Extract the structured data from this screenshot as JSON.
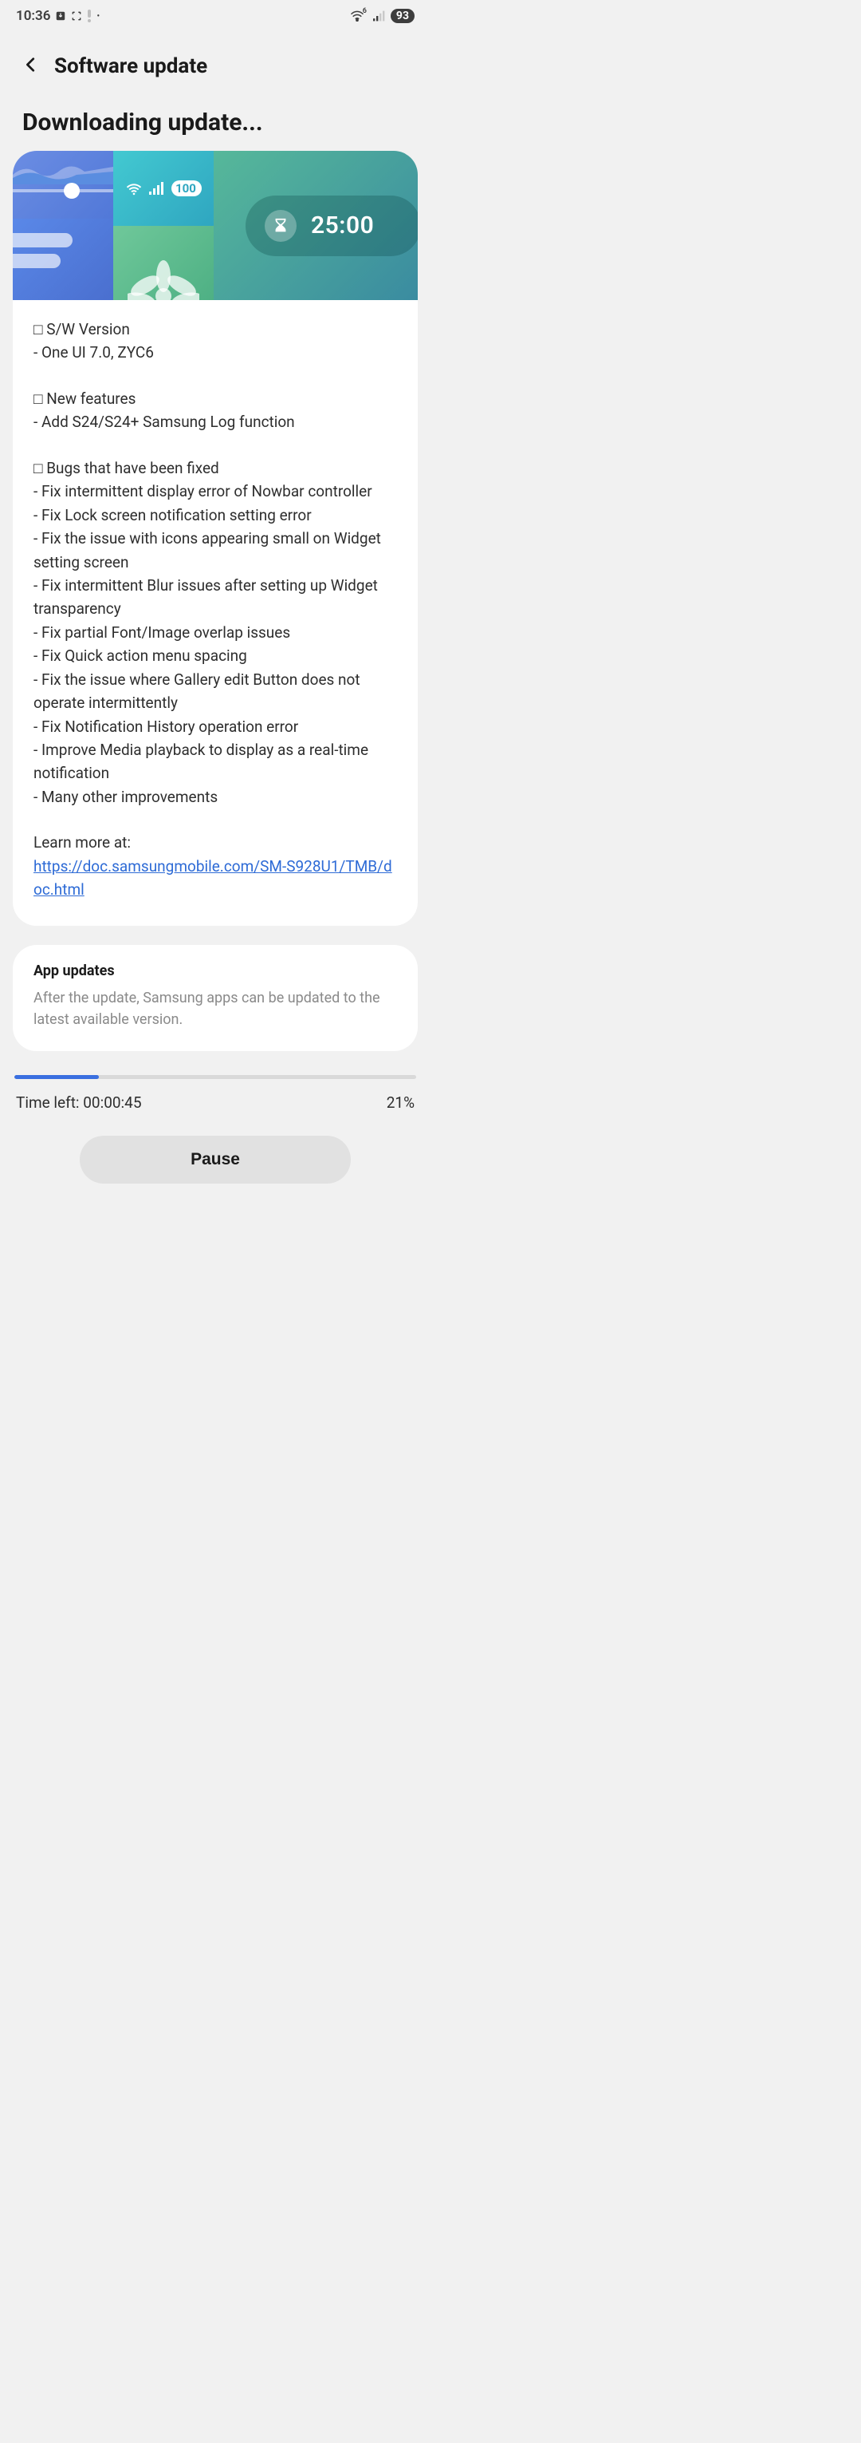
{
  "status_bar": {
    "time": "10:36",
    "battery": "93"
  },
  "header": {
    "title": "Software update"
  },
  "subtitle": "Downloading update...",
  "hero": {
    "battery_100": "100",
    "timer": "25:00"
  },
  "changelog": {
    "sw_version_head": "□ S/W Version",
    "sw_version_line": "- One UI 7.0, ZYC6",
    "new_features_head": "□ New features",
    "new_features_line": "- Add S24/S24+ Samsung Log function",
    "bugs_head": "□ Bugs that have been fixed",
    "bugs": [
      "- Fix intermittent display error of Nowbar controller",
      "- Fix Lock screen notification setting error",
      "- Fix the issue with icons appearing small on Widget setting screen",
      "- Fix intermittent Blur issues after setting up Widget transparency",
      "- Fix partial Font/Image overlap issues",
      "- Fix Quick action menu spacing",
      "- Fix the issue where Gallery edit Button does not operate intermittently",
      "- Fix Notification History operation error",
      "- Improve Media playback to display as a real-time notification",
      "- Many other improvements"
    ],
    "learn_more_label": "Learn more at:",
    "learn_more_url": "https://doc.samsungmobile.com/SM-S928U1/TMB/doc.html"
  },
  "app_updates": {
    "title": "App updates",
    "desc": "After the update, Samsung apps can be updated to the latest available version."
  },
  "progress": {
    "percent": 21,
    "time_left_label": "Time left: 00:00:45",
    "percent_label": "21%"
  },
  "buttons": {
    "pause": "Pause"
  }
}
